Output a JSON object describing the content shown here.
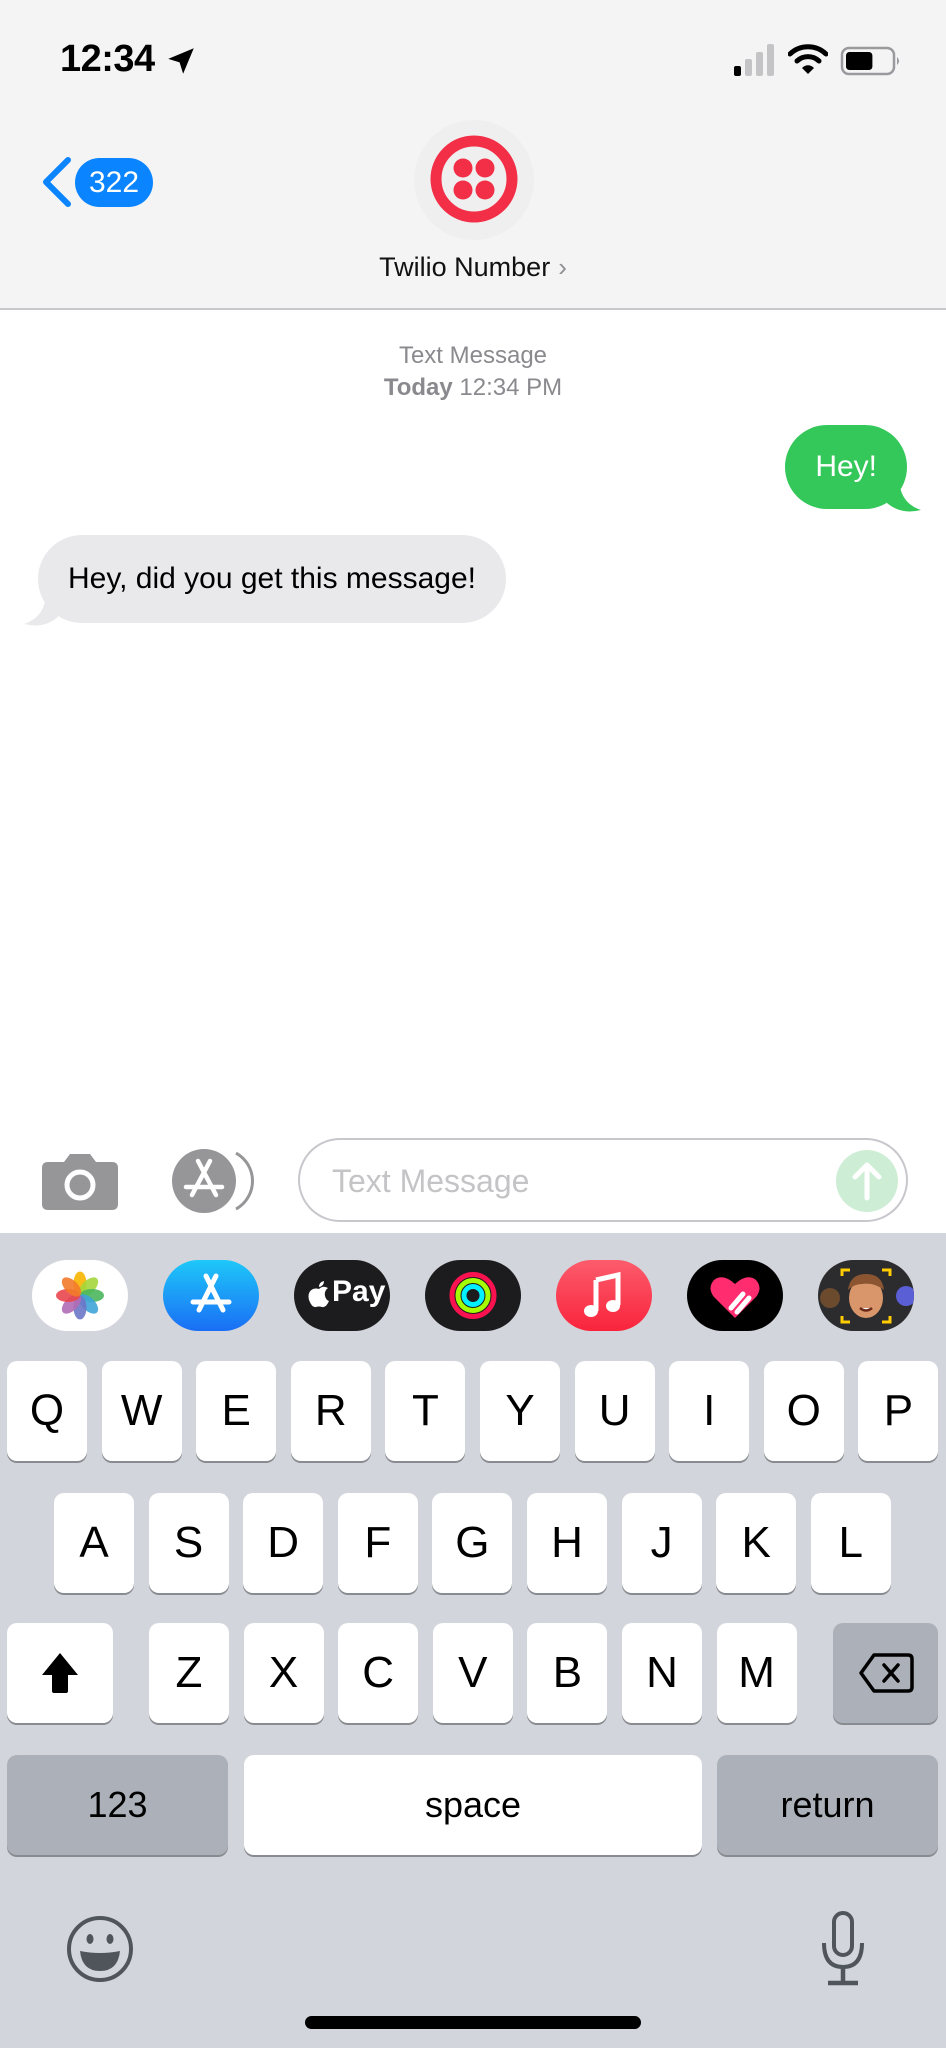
{
  "status_bar": {
    "time": "12:34",
    "location_icon": "location-arrow-icon",
    "signal_bars_active": 1,
    "signal_bars_total": 4,
    "wifi_icon": "wifi-icon",
    "battery_level": 0.6
  },
  "header": {
    "back_badge_count": "322",
    "contact_name": "Twilio Number",
    "contact_chevron": "›",
    "avatar_icon": "twilio-logo-icon",
    "brand_color": "#f22f46"
  },
  "conversation": {
    "service_label": "Text Message",
    "timestamp_day": "Today",
    "timestamp_time": "12:34 PM",
    "messages": [
      {
        "direction": "outgoing",
        "text": "Hey!",
        "color": "#34c759"
      },
      {
        "direction": "incoming",
        "text": "Hey, did you get this message!",
        "color": "#e9e9eb"
      }
    ]
  },
  "compose": {
    "placeholder": "Text Message",
    "value": "",
    "camera_icon": "camera-icon",
    "apps_icon": "app-store-icon",
    "send_icon": "arrow-up-icon"
  },
  "app_strip": [
    {
      "name": "photos",
      "icon": "photos-icon"
    },
    {
      "name": "app-store",
      "icon": "app-store-icon"
    },
    {
      "name": "apple-pay",
      "icon": "apple-pay-icon",
      "label": "Pay"
    },
    {
      "name": "activity",
      "icon": "activity-rings-icon"
    },
    {
      "name": "music",
      "icon": "music-note-icon"
    },
    {
      "name": "digital-touch",
      "icon": "heart-touch-icon"
    },
    {
      "name": "memoji",
      "icon": "memoji-icon"
    }
  ],
  "keyboard": {
    "row1": [
      "Q",
      "W",
      "E",
      "R",
      "T",
      "Y",
      "U",
      "I",
      "O",
      "P"
    ],
    "row2": [
      "A",
      "S",
      "D",
      "F",
      "G",
      "H",
      "J",
      "K",
      "L"
    ],
    "row3": [
      "Z",
      "X",
      "C",
      "V",
      "B",
      "N",
      "M"
    ],
    "shift_icon": "shift-icon",
    "delete_icon": "delete-icon",
    "numbers_label": "123",
    "space_label": "space",
    "return_label": "return",
    "emoji_icon": "emoji-icon",
    "mic_icon": "microphone-icon"
  }
}
